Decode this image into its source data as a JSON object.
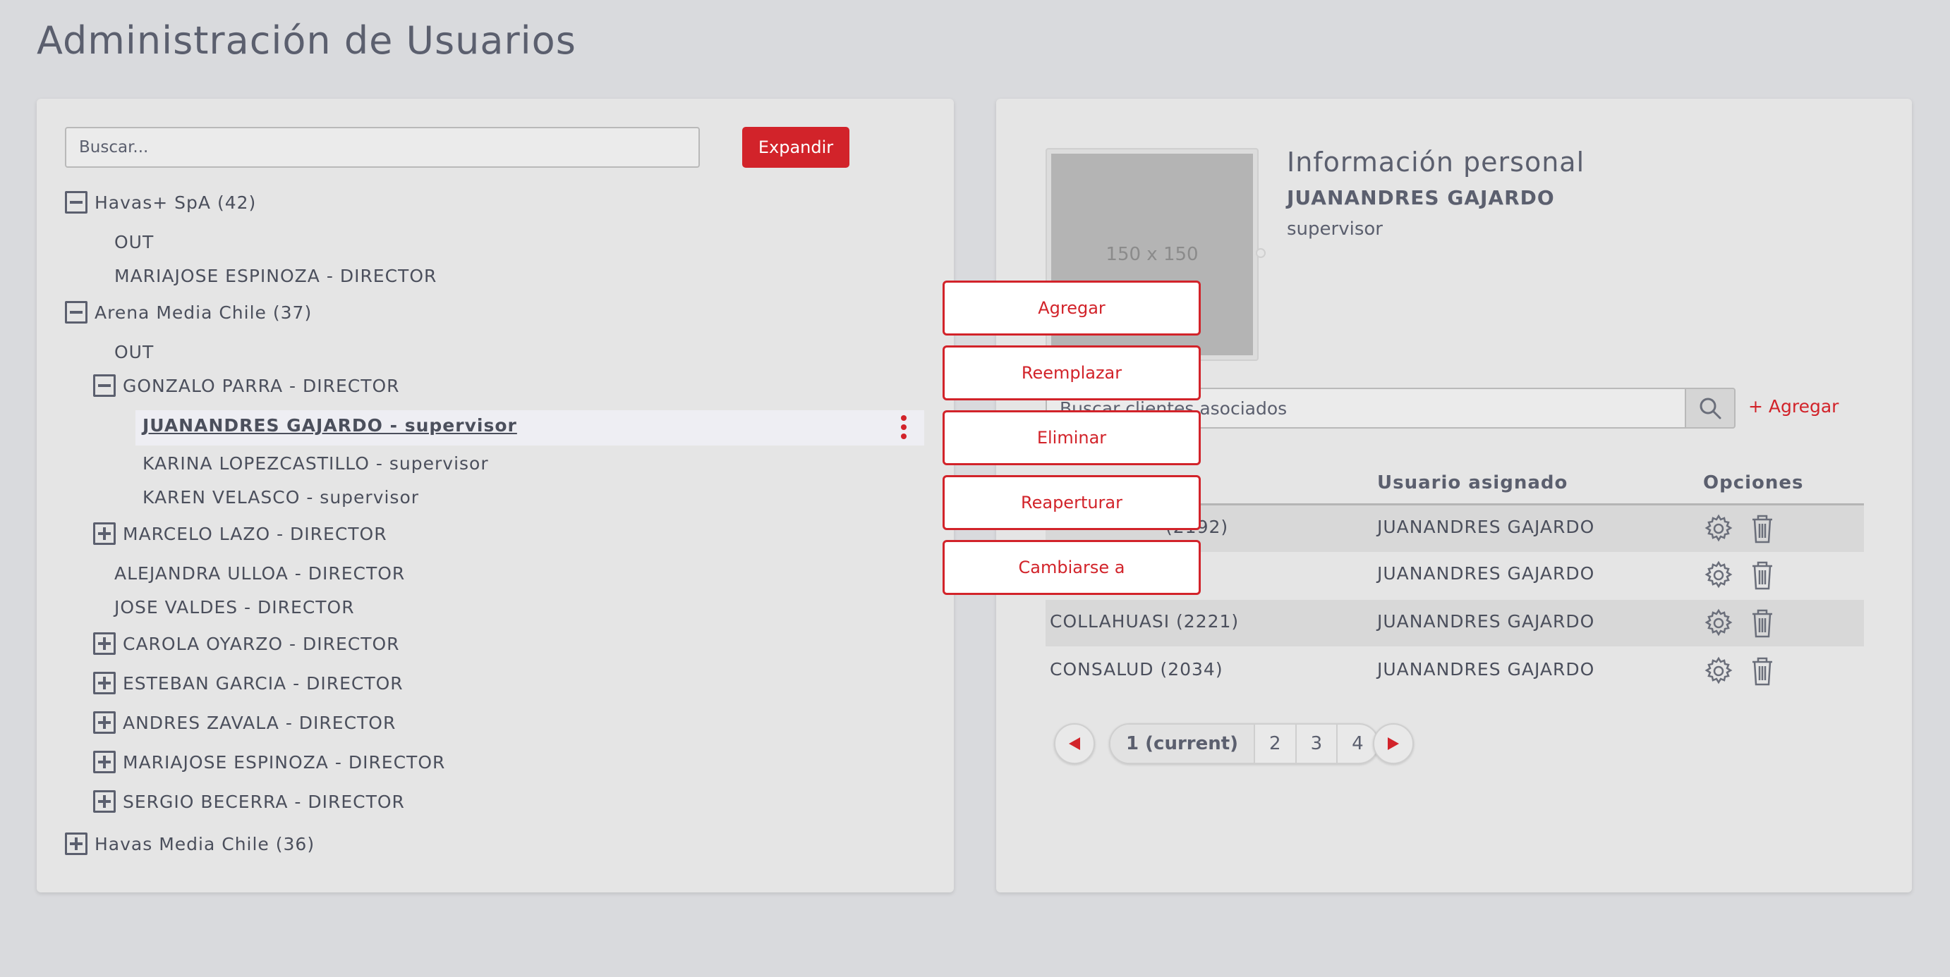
{
  "page": {
    "title": "Administración de Usuarios"
  },
  "colors": {
    "accent": "#d2232a",
    "background": "#d9dadd",
    "panel": "#e5e5e5"
  },
  "left": {
    "search_placeholder": "Buscar...",
    "expand_label": "Expandir",
    "tree": {
      "havas_spa": "Havas+ SpA (42)",
      "havas_out": "OUT",
      "havas_mariajose": "MARIAJOSE ESPINOZA - DIRECTOR",
      "arena": "Arena Media Chile (37)",
      "arena_out": "OUT",
      "gonzalo": "GONZALO PARRA - DIRECTOR",
      "juanandres": "JUANANDRES GAJARDO - supervisor",
      "karina": "KARINA LOPEZCASTILLO - supervisor",
      "karen": "KAREN VELASCO - supervisor",
      "marcelo": "MARCELO LAZO - DIRECTOR",
      "alejandra": "ALEJANDRA ULLOA - DIRECTOR",
      "jose": "JOSE VALDES - DIRECTOR",
      "carola": "CAROLA OYARZO - DIRECTOR",
      "esteban": "ESTEBAN GARCIA - DIRECTOR",
      "andres": "ANDRES ZAVALA - DIRECTOR",
      "mariajose2": "MARIAJOSE ESPINOZA - DIRECTOR",
      "sergio": "SERGIO BECERRA - DIRECTOR",
      "havas_media": "Havas Media Chile (36)"
    }
  },
  "context_menu": {
    "items": [
      "Agregar",
      "Reemplazar",
      "Eliminar",
      "Reaperturar",
      "Cambiarse a"
    ]
  },
  "right": {
    "avatar_text": "150 x 150",
    "info_title": "Información personal",
    "user_name": "JUANANDRES GAJARDO",
    "user_role": "supervisor",
    "client_search_placeholder": "Buscar clientes asociados",
    "add_label": "+ Agregar",
    "columns": {
      "user": "Usuario asignado",
      "options": "Opciones"
    },
    "rows": [
      {
        "client": "(2192)",
        "user": "JUANANDRES GAJARDO"
      },
      {
        "client": "",
        "user": "JUANANDRES GAJARDO"
      },
      {
        "client": "COLLAHUASI (2221)",
        "user": "JUANANDRES GAJARDO"
      },
      {
        "client": "CONSALUD (2034)",
        "user": "JUANANDRES GAJARDO"
      }
    ],
    "pagination": [
      "1 (current)",
      "2",
      "3",
      "4"
    ]
  }
}
